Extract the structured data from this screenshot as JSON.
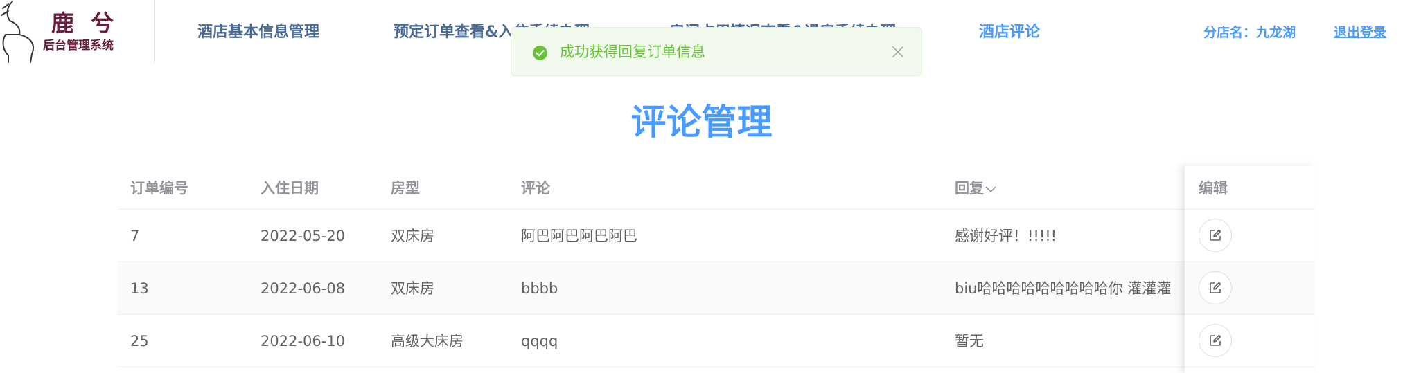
{
  "brand": {
    "title": "鹿兮",
    "subtitle": "后台管理系统",
    "logo_icon": "deer-antler-icon",
    "color": "#6b1e3e"
  },
  "nav": {
    "items": [
      {
        "label": "酒店基本信息管理",
        "active": false
      },
      {
        "label": "预定订单查看&入住手续办理",
        "active": false
      },
      {
        "label": "房间占用情况查看&退房手续办理",
        "active": false
      },
      {
        "label": "酒店评论",
        "active": true
      }
    ],
    "branch_label": "分店名：九龙湖",
    "logout_label": "退出登录"
  },
  "toast": {
    "type": "success",
    "message": "成功获得回复订单信息",
    "icon": "check-circle-icon",
    "close_icon": "close-icon"
  },
  "page": {
    "title": "评论管理"
  },
  "table": {
    "columns": {
      "order_id": "订单编号",
      "checkin_date": "入住日期",
      "room_type": "房型",
      "comment": "评论",
      "reply": "回复",
      "edit": "编辑"
    },
    "sort_icon": "chevron-down-icon",
    "edit_icon": "edit-icon",
    "rows": [
      {
        "order_id": "7",
        "checkin_date": "2022-05-20",
        "room_type": "双床房",
        "comment": "阿巴阿巴阿巴阿巴",
        "reply": "感谢好评！!!!!!"
      },
      {
        "order_id": "13",
        "checkin_date": "2022-06-08",
        "room_type": "双床房",
        "comment": "bbbb",
        "reply": "biu哈哈哈哈哈哈哈哈哈你 灌灌灌"
      },
      {
        "order_id": "25",
        "checkin_date": "2022-06-10",
        "room_type": "高级大床房",
        "comment": "qqqq",
        "reply": "暂无"
      }
    ]
  },
  "colors": {
    "accent": "#4a9bff",
    "nav_text": "#4a6a96",
    "success_text": "#67c23a",
    "success_bg": "#f0f9eb"
  }
}
